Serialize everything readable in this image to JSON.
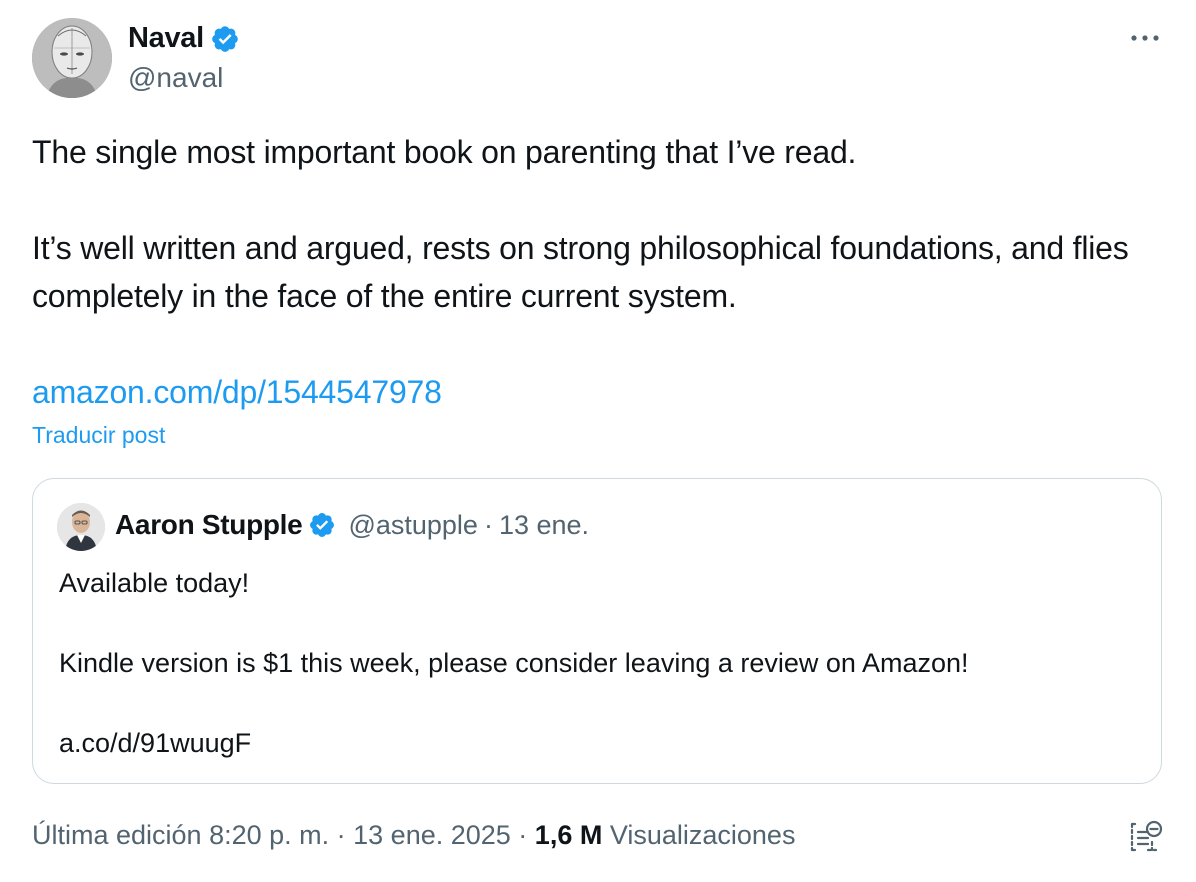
{
  "author": {
    "display_name": "Naval",
    "handle": "@naval",
    "verified": true,
    "avatar_icon": "portrait-sketch-avatar"
  },
  "more_icon": "more-dots-icon",
  "tweet": {
    "paragraph_1": "The single most important book on parenting that I’ve read.",
    "paragraph_2": "It’s well written and argued, rests on strong philosophical foundations, and flies completely in the face of the entire current system.",
    "link": "amazon.com/dp/1544547978",
    "translate_label": "Traducir post"
  },
  "quote": {
    "display_name": "Aaron Stupple",
    "handle": "@astupple",
    "separator": "·",
    "date": "13 ene.",
    "verified": true,
    "paragraph_1": "Available today!",
    "paragraph_2": "Kindle version is $1 this week, please consider leaving a review on Amazon!",
    "link": "a.co/d/91wuugF"
  },
  "meta": {
    "edited_label": "Última edición 8:20 p. m.",
    "sep1": " · ",
    "date": "13 ene. 2025",
    "sep2": " · ",
    "views_count": "1,6 M",
    "views_label": " Visualizaciones"
  },
  "colors": {
    "accent": "#1d9bf0",
    "text_primary": "#0f1419",
    "text_secondary": "#536471",
    "border": "#cfd9de"
  }
}
